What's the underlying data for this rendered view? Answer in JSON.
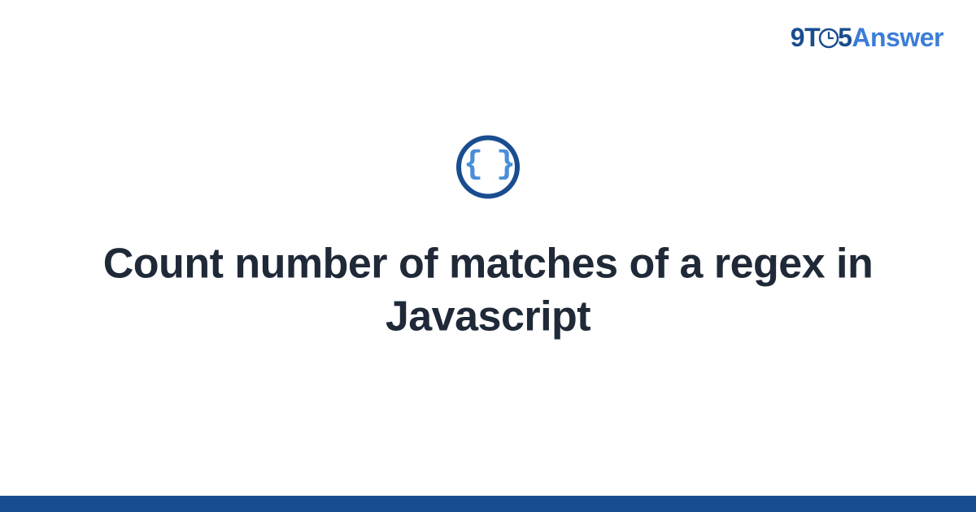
{
  "logo": {
    "part1": "9T",
    "part2": "5",
    "part3": "Answer"
  },
  "icon": {
    "braces": "{ }"
  },
  "title": "Count number of matches of a regex in Javascript"
}
